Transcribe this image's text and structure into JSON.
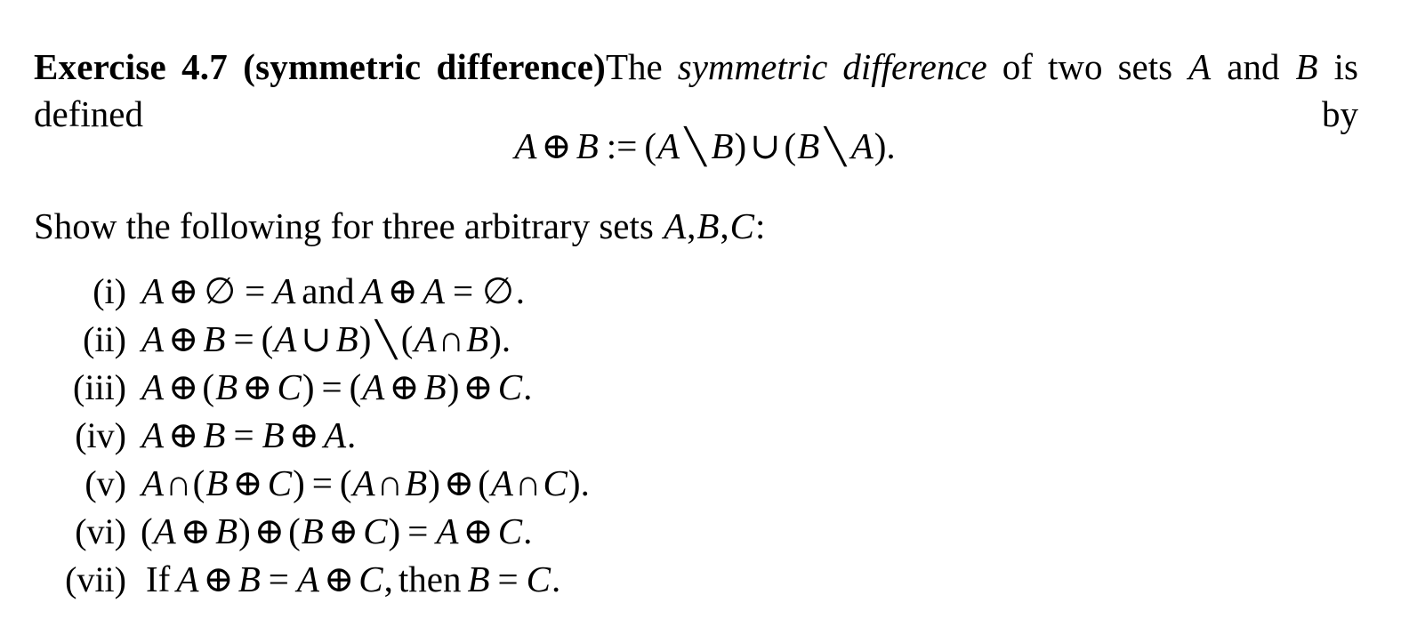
{
  "document": {
    "exercise_heading": "Exercise 4.7 (symmetric difference)",
    "intro": {
      "text_before_italic": "The ",
      "italic_term": "symmetric difference",
      "text_after_italic": " of two sets ",
      "var_a": "A",
      "word_and": " and ",
      "var_b": "B",
      "text_end": " is defined by"
    },
    "display_equation": {
      "lhs_a": "A",
      "oplus": "⊕",
      "lhs_b": "B",
      "define": ":=",
      "open1": "(",
      "r1_a": "A",
      "setminus1": "╲",
      "r1_b": "B",
      "close1": ")",
      "cup": "∪",
      "open2": "(",
      "r2_b": "B",
      "setminus2": "╲",
      "r2_a": "A",
      "close2": ")",
      "period": "."
    },
    "show_line": {
      "prefix": "Show the following for three arbitrary sets ",
      "var_a": "A",
      "comma1": ",",
      "var_b": "B",
      "comma2": ",",
      "var_c": "C",
      "colon": ":"
    },
    "list": [
      {
        "label": "(i)",
        "parts": [
          {
            "t": "A",
            "k": "var"
          },
          {
            "t": "⊕",
            "k": "op"
          },
          {
            "t": "∅",
            "k": "emptyset"
          },
          {
            "t": "=",
            "k": "rel"
          },
          {
            "t": "A",
            "k": "var"
          },
          {
            "t": "and",
            "k": "word"
          },
          {
            "t": "A",
            "k": "var"
          },
          {
            "t": "⊕",
            "k": "op"
          },
          {
            "t": "A",
            "k": "var"
          },
          {
            "t": "=",
            "k": "rel"
          },
          {
            "t": "∅",
            "k": "emptyset"
          },
          {
            "t": ".",
            "k": "punct"
          }
        ]
      },
      {
        "label": "(ii)",
        "parts": [
          {
            "t": "A",
            "k": "var"
          },
          {
            "t": "⊕",
            "k": "op"
          },
          {
            "t": "B",
            "k": "var"
          },
          {
            "t": "=",
            "k": "rel"
          },
          {
            "t": "(",
            "k": "paren"
          },
          {
            "t": "A",
            "k": "var"
          },
          {
            "t": "∪",
            "k": "op"
          },
          {
            "t": "B",
            "k": "var"
          },
          {
            "t": ")",
            "k": "paren"
          },
          {
            "t": "╲",
            "k": "setminus"
          },
          {
            "t": "(",
            "k": "paren"
          },
          {
            "t": "A",
            "k": "var"
          },
          {
            "t": "∩",
            "k": "optight"
          },
          {
            "t": "B",
            "k": "var"
          },
          {
            "t": ")",
            "k": "paren"
          },
          {
            "t": ".",
            "k": "punct"
          }
        ]
      },
      {
        "label": "(iii)",
        "parts": [
          {
            "t": "A",
            "k": "var"
          },
          {
            "t": "⊕",
            "k": "op"
          },
          {
            "t": "(",
            "k": "paren"
          },
          {
            "t": "B",
            "k": "var"
          },
          {
            "t": "⊕",
            "k": "op"
          },
          {
            "t": "C",
            "k": "var"
          },
          {
            "t": ")",
            "k": "paren"
          },
          {
            "t": "=",
            "k": "rel"
          },
          {
            "t": "(",
            "k": "paren"
          },
          {
            "t": "A",
            "k": "var"
          },
          {
            "t": "⊕",
            "k": "op"
          },
          {
            "t": "B",
            "k": "var"
          },
          {
            "t": ")",
            "k": "paren"
          },
          {
            "t": "⊕",
            "k": "op"
          },
          {
            "t": "C",
            "k": "var"
          },
          {
            "t": ".",
            "k": "punct"
          }
        ]
      },
      {
        "label": "(iv)",
        "parts": [
          {
            "t": "A",
            "k": "var"
          },
          {
            "t": "⊕",
            "k": "op"
          },
          {
            "t": "B",
            "k": "var"
          },
          {
            "t": "=",
            "k": "rel"
          },
          {
            "t": "B",
            "k": "var"
          },
          {
            "t": "⊕",
            "k": "op"
          },
          {
            "t": "A",
            "k": "var"
          },
          {
            "t": ".",
            "k": "punct"
          }
        ]
      },
      {
        "label": "(v)",
        "parts": [
          {
            "t": "A",
            "k": "var"
          },
          {
            "t": "∩",
            "k": "optight"
          },
          {
            "t": "(",
            "k": "paren"
          },
          {
            "t": "B",
            "k": "var"
          },
          {
            "t": "⊕",
            "k": "op"
          },
          {
            "t": "C",
            "k": "var"
          },
          {
            "t": ")",
            "k": "paren"
          },
          {
            "t": "=",
            "k": "rel"
          },
          {
            "t": "(",
            "k": "paren"
          },
          {
            "t": "A",
            "k": "var"
          },
          {
            "t": "∩",
            "k": "optight"
          },
          {
            "t": "B",
            "k": "var"
          },
          {
            "t": ")",
            "k": "paren"
          },
          {
            "t": "⊕",
            "k": "op"
          },
          {
            "t": "(",
            "k": "paren"
          },
          {
            "t": "A",
            "k": "var"
          },
          {
            "t": "∩",
            "k": "optight"
          },
          {
            "t": "C",
            "k": "var"
          },
          {
            "t": ")",
            "k": "paren"
          },
          {
            "t": ".",
            "k": "punct"
          }
        ]
      },
      {
        "label": "(vi)",
        "parts": [
          {
            "t": "(",
            "k": "paren"
          },
          {
            "t": "A",
            "k": "var"
          },
          {
            "t": "⊕",
            "k": "op"
          },
          {
            "t": "B",
            "k": "var"
          },
          {
            "t": ")",
            "k": "paren"
          },
          {
            "t": "⊕",
            "k": "op"
          },
          {
            "t": "(",
            "k": "paren"
          },
          {
            "t": "B",
            "k": "var"
          },
          {
            "t": "⊕",
            "k": "op"
          },
          {
            "t": "C",
            "k": "var"
          },
          {
            "t": ")",
            "k": "paren"
          },
          {
            "t": "=",
            "k": "rel"
          },
          {
            "t": "A",
            "k": "var"
          },
          {
            "t": "⊕",
            "k": "op"
          },
          {
            "t": "C",
            "k": "var"
          },
          {
            "t": ".",
            "k": "punct"
          }
        ]
      },
      {
        "label": "(vii)",
        "parts": [
          {
            "t": "If",
            "k": "word"
          },
          {
            "t": "A",
            "k": "var"
          },
          {
            "t": "⊕",
            "k": "op"
          },
          {
            "t": "B",
            "k": "var"
          },
          {
            "t": "=",
            "k": "rel"
          },
          {
            "t": "A",
            "k": "var"
          },
          {
            "t": "⊕",
            "k": "op"
          },
          {
            "t": "C",
            "k": "var"
          },
          {
            "t": ",",
            "k": "punct"
          },
          {
            "t": "then",
            "k": "word"
          },
          {
            "t": "B",
            "k": "var"
          },
          {
            "t": "=",
            "k": "rel"
          },
          {
            "t": "C",
            "k": "var"
          },
          {
            "t": ".",
            "k": "punct"
          }
        ]
      }
    ]
  },
  "colors": {
    "background": "#ffffff",
    "text": "#000000"
  }
}
